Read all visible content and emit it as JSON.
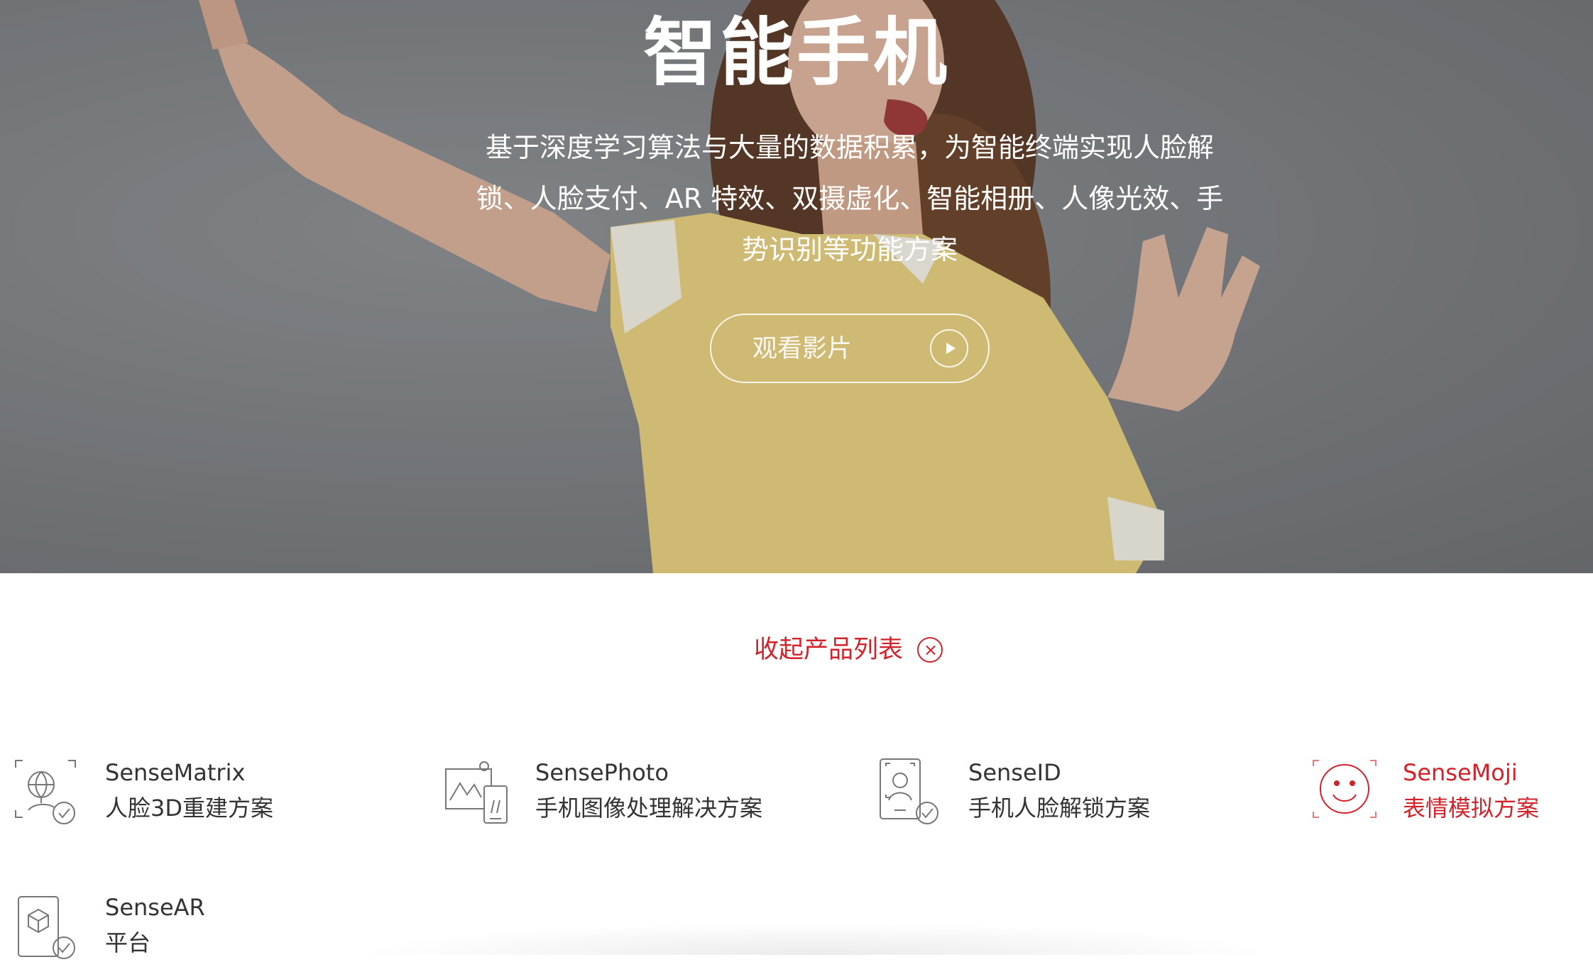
{
  "hero": {
    "title": "智能手机",
    "description": "基于深度学习算法与大量的数据积累，为智能终端实现人脸解锁、人脸支付、AR 特效、双摄虚化、智能相册、人像光效、手势识别等功能方案",
    "watch_button_label": "观看影片"
  },
  "collapse": {
    "label": "收起产品列表"
  },
  "products": [
    {
      "name": "SenseMatrix",
      "desc": "人脸3D重建方案",
      "icon": "face-3d-icon"
    },
    {
      "name": "SensePhoto",
      "desc": "手机图像处理解决方案",
      "icon": "photo-phone-icon"
    },
    {
      "name": "SenseID",
      "desc": "手机人脸解锁方案",
      "icon": "face-id-icon"
    },
    {
      "name": "SenseMoji",
      "desc": "表情模拟方案",
      "icon": "smiley-icon",
      "active": true
    },
    {
      "name": "SenseAR",
      "desc": "平台",
      "icon": "ar-cube-icon"
    }
  ],
  "colors": {
    "accent": "#d3222a",
    "text": "#333333",
    "icon_gray": "#777777"
  }
}
